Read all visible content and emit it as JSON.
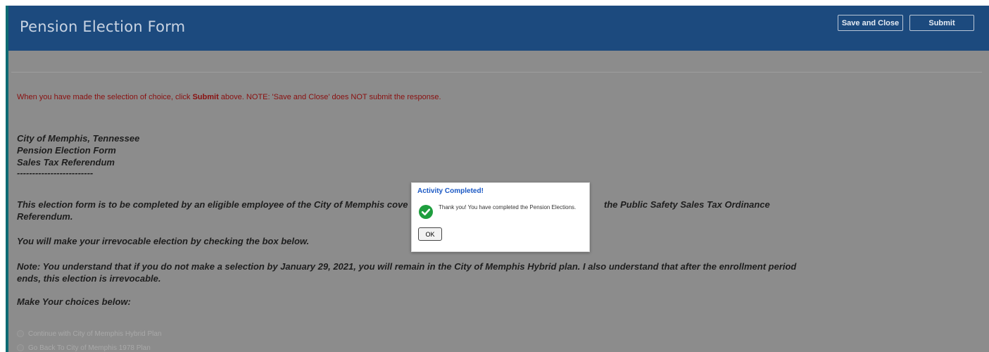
{
  "header": {
    "title": "Pension Election Form",
    "save_close_label": "Save and Close",
    "submit_label": "Submit"
  },
  "notice": {
    "before": "When you have made the selection of choice, click ",
    "emphasis": "Submit",
    "after": " above. NOTE: 'Save and Close' does NOT submit the response."
  },
  "form": {
    "heading_lines": [
      "City of Memphis, Tennessee",
      "Pension Election Form",
      "Sales Tax Referendum",
      "-------------------------"
    ],
    "para_election_start": "This election form is to be completed by an eligible employee of the City of Memphis cove",
    "para_election_end": "the Public Safety Sales Tax Ordinance",
    "para_election_cont": "Referendum.",
    "para_irrevocable": "You will make your irrevocable election by checking the box below.",
    "para_note": "Note: You understand that if you do not make a selection by January 29, 2021, you will remain in the City of Memphis Hybrid plan. I also understand that after the enrollment period ends, this election is irrevocable.",
    "para_choices": "Make Your choices below:",
    "options": [
      "Continue with City of Memphis Hybrid Plan",
      "Go Back To City of Memphis 1978 Plan"
    ]
  },
  "dialog": {
    "title": "Activity Completed!",
    "message": "Thank you! You have completed the Pension Elections.",
    "ok_label": "OK",
    "icon": "check-circle-icon",
    "icon_color": "#1e9e3e"
  },
  "colors": {
    "header_bg": "#1c4a7e",
    "overlay_bg": "#8c8c8c",
    "notice_text": "#8a1010"
  }
}
